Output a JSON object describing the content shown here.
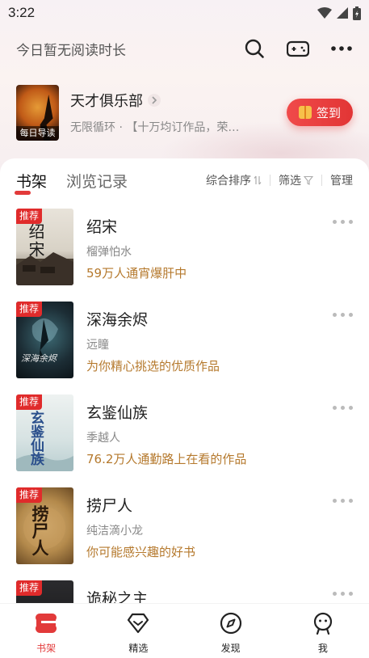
{
  "status_bar": {
    "time": "3:22"
  },
  "header": {
    "reading_time": "今日暂无阅读时长",
    "icons": [
      "search-icon",
      "gamepad-icon",
      "more-icon"
    ]
  },
  "club": {
    "cover_label": "每日导读",
    "title": "天才俱乐部",
    "subtitle": "无限循环 · 【十万均订作品，荣…",
    "signin_label": "签到"
  },
  "tabs": {
    "active": "书架",
    "other": "浏览记录",
    "sort_label": "综合排序",
    "filter_label": "筛选",
    "manage_label": "管理"
  },
  "books": [
    {
      "badge": "推荐",
      "title": "绍宋",
      "author": "榴弹怕水",
      "tagline": "59万人通宵爆肝中",
      "cover_text": "绍宋"
    },
    {
      "badge": "推荐",
      "title": "深海余烬",
      "author": "远瞳",
      "tagline": "为你精心挑选的优质作品",
      "cover_text": "深海余烬"
    },
    {
      "badge": "推荐",
      "title": "玄鉴仙族",
      "author": "季越人",
      "tagline": "76.2万人通勤路上在看的作品",
      "cover_text": "玄鉴仙族"
    },
    {
      "badge": "推荐",
      "title": "捞尸人",
      "author": "纯洁滴小龙",
      "tagline": "你可能感兴趣的好书",
      "cover_text": "捞尸人"
    },
    {
      "badge": "推荐",
      "title": "诡秘之主",
      "author": "",
      "tagline": "",
      "cover_text": ""
    }
  ],
  "bottom_nav": [
    {
      "label": "书架",
      "icon": "bookshelf-icon"
    },
    {
      "label": "精选",
      "icon": "diamond-icon"
    },
    {
      "label": "发现",
      "icon": "compass-icon"
    },
    {
      "label": "我",
      "icon": "profile-icon"
    }
  ],
  "colors": {
    "accent": "#e23a3a",
    "tagline": "#b5792d"
  }
}
